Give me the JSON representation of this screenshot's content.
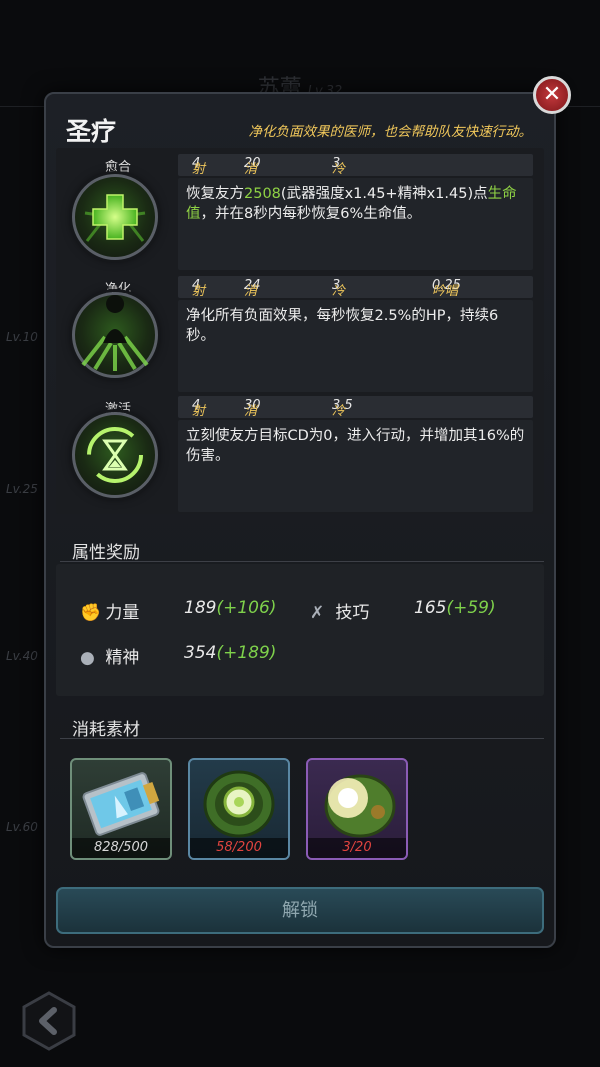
{
  "background": {
    "hero_name": "苏蕾",
    "hero_level": "Lv.32",
    "level_markers": [
      "Lv.10",
      "Lv.25",
      "Lv.40",
      "Lv.60"
    ]
  },
  "modal": {
    "title": "圣疗",
    "description": "净化负面效果的医师，也会帮助队友快速行动。",
    "close_icon": "close-icon"
  },
  "skills": [
    {
      "name": "愈合",
      "icon": "heal-cross-icon",
      "range_label": "射程",
      "range": "4",
      "mp_label": "消耗MP",
      "mp": "20",
      "cd_label": "冷却时间",
      "cd": "3",
      "cast_label": "",
      "cast": "",
      "desc_a": "恢复友方",
      "desc_b": "2508",
      "desc_c": "(武器强度x1.45+精神x1.45)点",
      "desc_d": "生命值",
      "desc_e": "，并在8秒内每秒恢复6%生命值。"
    },
    {
      "name": "净化",
      "icon": "purify-figure-icon",
      "range_label": "射程",
      "range": "4",
      "mp_label": "消耗MP",
      "mp": "24",
      "cd_label": "冷却时间",
      "cd": "3",
      "cast_label": "吟唱时间",
      "cast": "0.25",
      "desc": "净化所有负面效果，每秒恢复2.5%的HP，持续6秒。"
    },
    {
      "name": "激活",
      "icon": "hourglass-cycle-icon",
      "range_label": "射程",
      "range": "4",
      "mp_label": "消耗MP",
      "mp": "30",
      "cd_label": "冷却时间",
      "cd": "3.5",
      "cast_label": "",
      "cast": "",
      "desc": "立刻使友方目标CD为0，进入行动，并增加其16%的伤害。"
    }
  ],
  "attributes": {
    "title": "属性奖励",
    "items": [
      {
        "label": "力量",
        "base": "189",
        "bonus": "(+106)",
        "icon": "fist-icon"
      },
      {
        "label": "技巧",
        "base": "165",
        "bonus": "(+59)",
        "icon": "tools-icon"
      },
      {
        "label": "精神",
        "base": "354",
        "bonus": "(+189)",
        "icon": "head-icon"
      }
    ]
  },
  "materials": {
    "title": "消耗素材",
    "items": [
      {
        "count": "828/500",
        "count_color": "#d8d8d8",
        "icon": "data-chip-icon"
      },
      {
        "count": "58/200",
        "count_color": "#e0443f",
        "icon": "green-core-icon"
      },
      {
        "count": "3/20",
        "count_color": "#e0443f",
        "icon": "glowing-core-icon"
      }
    ]
  },
  "unlock_label": "解锁",
  "back_icon": "back-arrow-icon",
  "colors": {
    "accent_gold": "#f1c85b",
    "highlight_green": "#8fd245",
    "bonus_green": "#7ed14b",
    "insufficient_red": "#e0443f",
    "unlock_button": "#294a57"
  }
}
